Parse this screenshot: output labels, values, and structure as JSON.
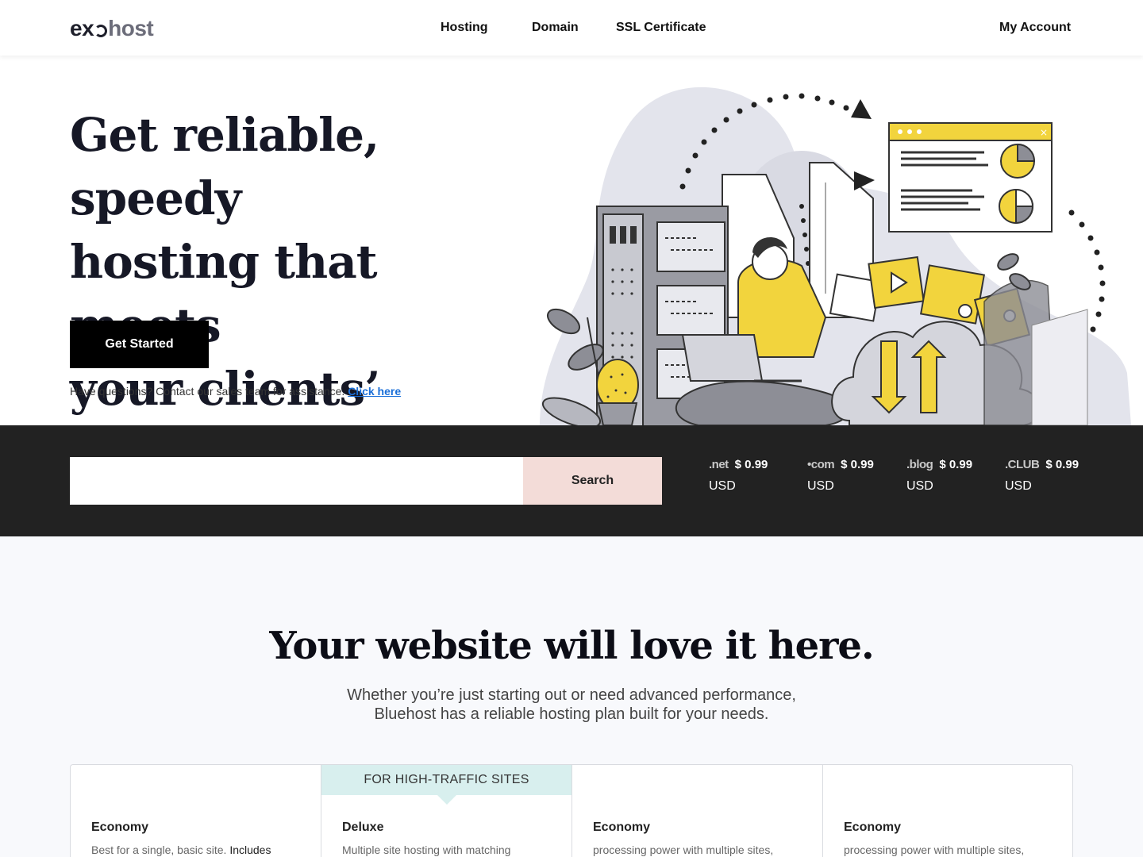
{
  "header": {
    "logo_left": "ex",
    "logo_right": "host",
    "nav": {
      "hosting": "Hosting",
      "domain": "Domain",
      "ssl": "SSL Certificate",
      "account": "My Account"
    }
  },
  "hero": {
    "title_line1": "Get reliable, speedy",
    "title_line2": "hosting that meets",
    "title_line3": "your clients’ needs.",
    "cta": "Get Started",
    "note": "Have questions? Contact our sales team for assistance.",
    "note_link": "Click here"
  },
  "search": {
    "placeholder": "",
    "button": "Search",
    "tlds": [
      {
        "name": ".net",
        "price": "$ 0.99",
        "currency": "USD"
      },
      {
        "name": "•com",
        "price": "$ 0.99",
        "currency": "USD"
      },
      {
        "name": ".blog",
        "price": "$ 0.99",
        "currency": "USD"
      },
      {
        "name": ".CLUB",
        "price": "$ 0.99",
        "currency": "USD"
      }
    ]
  },
  "section": {
    "title": "Your website will love it here.",
    "subtitle_line1": "Whether you’re just starting out or need advanced performance,",
    "subtitle_line2": "Bluehost has a reliable hosting plan built for your needs."
  },
  "plans": [
    {
      "badge": "",
      "name": "Economy",
      "desc": "Best for a single, basic site.",
      "desc_strong": "Includes"
    },
    {
      "badge": "FOR HIGH-TRAFFIC SITES",
      "name": "Deluxe",
      "desc": "Multiple site hosting with matching",
      "desc_strong": ""
    },
    {
      "badge": "",
      "name": "Economy",
      "desc": "processing power with multiple sites,",
      "desc_strong": ""
    },
    {
      "badge": "",
      "name": "Economy",
      "desc": "processing power with multiple sites,",
      "desc_strong": ""
    }
  ],
  "colors": {
    "accent_yellow": "#f2d43d",
    "dark_band": "#222222",
    "search_button": "#f3dcd8",
    "badge_bg": "#d8efee",
    "link": "#1b6fd8"
  }
}
